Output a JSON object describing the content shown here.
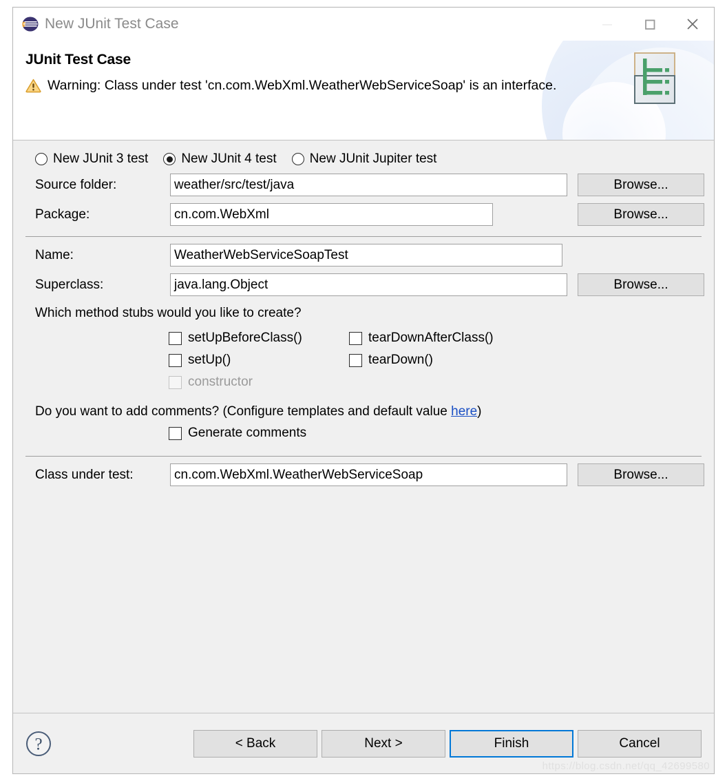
{
  "window": {
    "title": "New JUnit Test Case",
    "app_icon": "eclipse-icon",
    "controls": {
      "minimize": "minimize-icon",
      "maximize": "maximize-icon",
      "close": "close-icon"
    }
  },
  "banner": {
    "title": "JUnit Test Case",
    "warning_icon": "warning-icon",
    "warning_message": "Warning: Class under test 'cn.com.WebXml.WeatherWebServiceSoap' is an interface.",
    "wizard_icon": "junit-wizard-icon"
  },
  "test_kind": {
    "options": [
      {
        "label": "New JUnit 3 test",
        "selected": false
      },
      {
        "label": "New JUnit 4 test",
        "selected": true
      },
      {
        "label": "New JUnit Jupiter test",
        "selected": false
      }
    ]
  },
  "fields": {
    "source_folder": {
      "label": "Source folder:",
      "value": "weather/src/test/java",
      "browse_label": "Browse..."
    },
    "package": {
      "label": "Package:",
      "value": "cn.com.WebXml",
      "browse_label": "Browse..."
    },
    "name": {
      "label": "Name:",
      "value": "WeatherWebServiceSoapTest"
    },
    "superclass": {
      "label": "Superclass:",
      "value": "java.lang.Object",
      "browse_label": "Browse..."
    },
    "class_under_test": {
      "label": "Class under test:",
      "value": "cn.com.WebXml.WeatherWebServiceSoap",
      "browse_label": "Browse..."
    }
  },
  "stubs": {
    "question": "Which method stubs would you like to create?",
    "items": [
      {
        "label": "setUpBeforeClass()",
        "checked": false,
        "enabled": true
      },
      {
        "label": "tearDownAfterClass()",
        "checked": false,
        "enabled": true
      },
      {
        "label": "setUp()",
        "checked": false,
        "enabled": true
      },
      {
        "label": "tearDown()",
        "checked": false,
        "enabled": true
      },
      {
        "label": "constructor",
        "checked": false,
        "enabled": false
      }
    ]
  },
  "comments": {
    "prefix": "Do you want to add comments? (Configure templates and default value ",
    "link_text": "here",
    "suffix": ")",
    "checkbox_label": "Generate comments",
    "checked": false
  },
  "buttons": {
    "help_icon": "help-icon",
    "back": "< Back",
    "next": "Next >",
    "finish": "Finish",
    "cancel": "Cancel",
    "default_button": "Finish"
  },
  "watermark": "https://blog.csdn.net/qq_42699580",
  "colors": {
    "accent": "#0078d7",
    "link": "#1a4fc4",
    "window_bg": "#f0f0f0",
    "field_bg": "#ffffff",
    "warning": "#e8a33d",
    "junit_green": "#4aa06a"
  }
}
